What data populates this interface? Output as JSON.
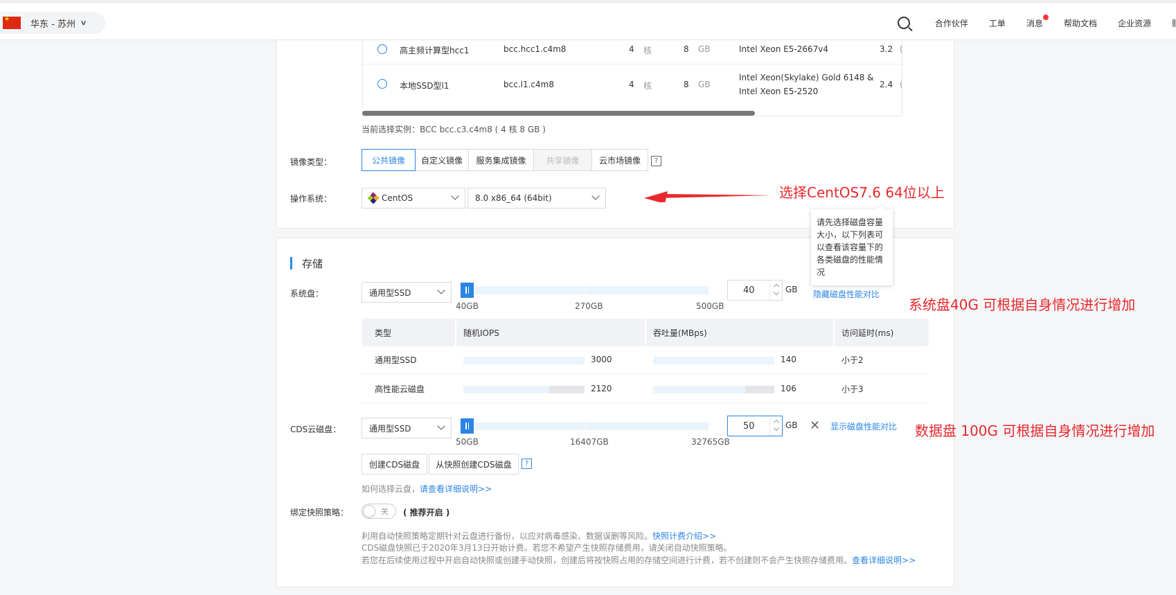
{
  "topbar": {
    "region": "华东 - 苏州",
    "nav": [
      "合作伙伴",
      "工单",
      "消息",
      "帮助文档",
      "企业资源",
      "财"
    ]
  },
  "instances": [
    {
      "name": "高主频计算型hcc1",
      "spec": "bcc.hcc1.c4m8",
      "cpu": "4",
      "cpu_unit": "核",
      "mem": "8",
      "mem_unit": "GB",
      "processor": "Intel Xeon E5-2667v4",
      "freq": "3.2",
      "extra": "("
    },
    {
      "name": "本地SSD型l1",
      "spec": "bcc.l1.c4m8",
      "cpu": "4",
      "cpu_unit": "核",
      "mem": "8",
      "mem_unit": "GB",
      "processor_line1": "Intel Xeon(Skylake) Gold 6148 &",
      "processor_line2": "Intel Xeon E5-2520",
      "freq": "2.4",
      "extra": "("
    }
  ],
  "current_instance": "当前选择实例：BCC bcc.c3.c4m8 ( 4 核 8 GB )",
  "image": {
    "label": "镜像类型：",
    "tabs": [
      "公共镜像",
      "自定义镜像",
      "服务集成镜像",
      "共享镜像",
      "云市场镜像"
    ],
    "help": "?"
  },
  "os": {
    "label": "操作系统：",
    "distro": "CentOS",
    "version": "8.0 x86_64 (64bit)"
  },
  "annotations": {
    "os": "选择CentOS7.6 64位以上",
    "system_disk": "系统盘40G  可根据自身情况进行增加",
    "data_disk": "数据盘 100G  可根据自身情况进行增加"
  },
  "storage": {
    "title": "存储",
    "tooltip": "请先选择磁盘容量大小，以下列表可以查看该容量下的各类磁盘的性能情况",
    "system_disk": {
      "label": "系统盘：",
      "type": "通用型SSD",
      "min": "40GB",
      "mid": "270GB",
      "max": "500GB",
      "value": "40",
      "unit": "GB",
      "link": "隐藏磁盘性能对比"
    },
    "perf_table": {
      "headers": [
        "类型",
        "随机IOPS",
        "吞吐量(MBps)",
        "访问延时(ms)"
      ],
      "rows": [
        {
          "type": "通用型SSD",
          "iops": "3000",
          "iops_fill": 1.0,
          "throughput": "140",
          "tp_fill": 1.0,
          "latency": "小于2"
        },
        {
          "type": "高性能云磁盘",
          "iops": "2120",
          "iops_fill": 0.71,
          "throughput": "106",
          "tp_fill": 0.76,
          "latency": "小于3"
        }
      ]
    },
    "cds_disk": {
      "label": "CDS云磁盘：",
      "type": "通用型SSD",
      "min": "50GB",
      "mid": "16407GB",
      "max": "32765GB",
      "value": "50",
      "unit": "GB",
      "close": "✕",
      "link": "显示磁盘性能对比"
    },
    "buttons": [
      "创建CDS磁盘",
      "从快照创建CDS磁盘"
    ],
    "help": "?",
    "how_text": "如何选择云盘，",
    "how_link": "请查看详细说明>>"
  },
  "snapshot": {
    "label": "绑定快照策略：",
    "toggle": "关",
    "recommend": "( 推荐开启 )",
    "note1": "利用自动快照策略定期针对云盘进行备份，以应对病毒感染、数据误删等风险。",
    "note1_link": "快照计费介绍>>",
    "note2": "CDS磁盘快照已于2020年3月13日开始计费。若您不希望产生快照存储费用，请关闭自动快照策略。",
    "note3": "若您在后续使用过程中开启自动快照或创建手动快照，创建后将按快照占用的存储空间进行计费，若不创建则不会产生快照存储费用。",
    "note3_link": "查看详细说明>>"
  },
  "colors": {
    "accent": "#2b85e4",
    "annotation": "#e8282c"
  }
}
